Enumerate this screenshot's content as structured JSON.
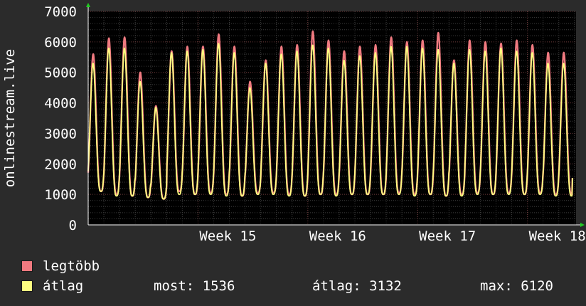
{
  "chart_data": {
    "type": "line",
    "ylabel": "onlinestream.live",
    "ylim": [
      0,
      7000
    ],
    "y_ticks": [
      "0",
      "1000",
      "2000",
      "3000",
      "4000",
      "5000",
      "6000",
      "7000"
    ],
    "x_ticks": [
      {
        "label": "Week 15",
        "day": 7
      },
      {
        "label": "Week 16",
        "day": 14
      },
      {
        "label": "Week 17",
        "day": 21
      },
      {
        "label": "Week 18",
        "day": 28
      }
    ],
    "x_range_days": [
      0,
      31.1
    ],
    "grid": true,
    "series": [
      {
        "name": "legtöbb",
        "color": "#f07a80",
        "daily_peaks": [
          5600,
          6120,
          6150,
          5000,
          3900,
          5700,
          5850,
          5850,
          6250,
          5850,
          4700,
          5400,
          5850,
          5900,
          6350,
          6050,
          5700,
          5850,
          5900,
          6150,
          6000,
          6050,
          6300,
          5400,
          6050,
          6000,
          5950,
          6050,
          5900,
          5650
        ],
        "daily_troughs": [
          1100,
          1000,
          950,
          900,
          850,
          1100,
          1000,
          1050,
          1000,
          950,
          1050,
          1050,
          1000,
          950,
          1000,
          1000,
          1000,
          1000,
          1000,
          1050,
          1000,
          1000,
          950,
          1000,
          1050,
          1000,
          1050,
          1000,
          1050,
          1000
        ],
        "last": 1536
      },
      {
        "name": "átlag",
        "color": "#ffff80",
        "daily_peaks": [
          5300,
          5800,
          5800,
          4700,
          3850,
          5650,
          5700,
          5750,
          5950,
          5650,
          4500,
          5300,
          5600,
          5700,
          5900,
          5800,
          5400,
          5550,
          5650,
          5850,
          5850,
          5800,
          5750,
          5300,
          5750,
          5700,
          5800,
          5700,
          5650,
          5300
        ],
        "daily_troughs": [
          1100,
          950,
          950,
          900,
          850,
          1000,
          1000,
          1000,
          950,
          950,
          1000,
          1000,
          950,
          950,
          1000,
          950,
          1000,
          1000,
          1000,
          1000,
          950,
          1000,
          950,
          950,
          1000,
          1000,
          1000,
          1000,
          1000,
          950
        ],
        "last": 1536
      }
    ]
  },
  "legend": {
    "max_label": "legtöbb",
    "avg_label": "átlag",
    "max_color": "#f07a80",
    "avg_color": "#ffff80"
  },
  "stats": {
    "now": "most: 1536",
    "avg": "átlag: 3132",
    "max": "max: 6120"
  }
}
